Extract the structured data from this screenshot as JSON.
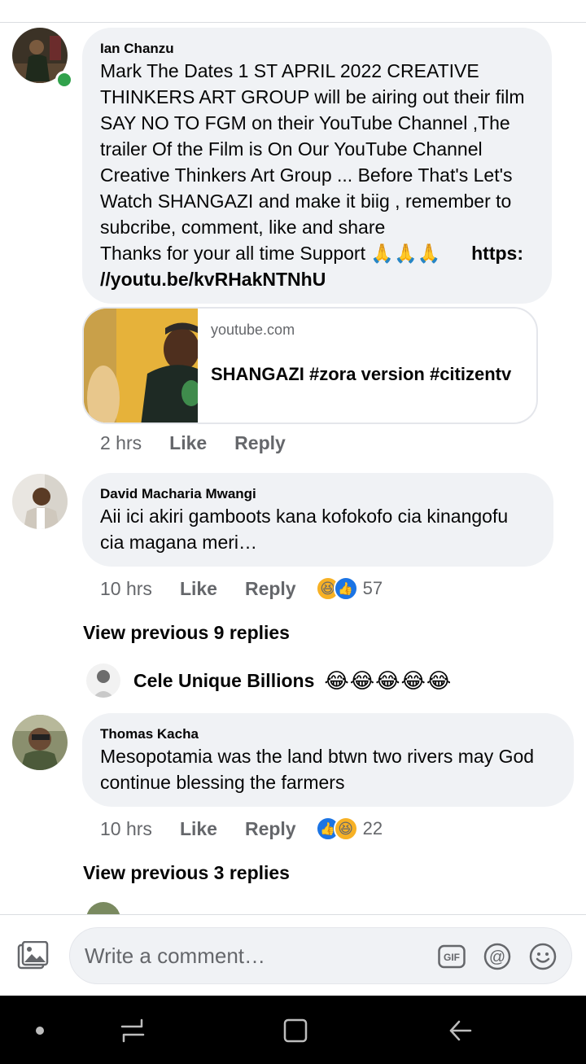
{
  "comments": [
    {
      "author": "Ian Chanzu",
      "lines": [
        "Mark The Dates 1 ST APRIL 2022 CREATIVE",
        "THINKERS ART GROUP will be airing out their film",
        "SAY NO TO FGM on their YouTube Channel ,The",
        "trailer Of the Film is On Our YouTube Channel",
        "Creative Thinkers Art Group ... Before That's Let's",
        "Watch SHANGAZI and make it biig , remember to",
        "subcribe, comment, like and share"
      ],
      "support_text": "Thanks for your all time Support 🙏🙏🙏",
      "link_part1": "https:",
      "link_part2": "//youtu.be/kvRHakNTNhU",
      "link_preview": {
        "domain": "youtube.com",
        "title": "SHANGAZI #zora version #citizentv"
      },
      "time": "2 hrs",
      "like_label": "Like",
      "reply_label": "Reply",
      "online": true
    },
    {
      "author": "David Macharia Mwangi",
      "lines": [
        "Aii ici akiri gamboots kana kofokofo cia kinangofu",
        "cia magana meri…"
      ],
      "time": "10 hrs",
      "like_label": "Like",
      "reply_label": "Reply",
      "reactions": [
        "haha",
        "like"
      ],
      "reaction_count": "57",
      "view_previous": "View previous 9 replies",
      "latest_reply": {
        "author": "Cele Unique Billions",
        "text": "😂😂😂😂😂"
      }
    },
    {
      "author": "Thomas Kacha",
      "lines": [
        "Mesopotamia was the land btwn two rivers may God",
        "continue blessing the farmers"
      ],
      "time": "10 hrs",
      "like_label": "Like",
      "reply_label": "Reply",
      "reactions": [
        "like",
        "haha"
      ],
      "reaction_count": "22",
      "view_previous": "View previous 3 replies"
    }
  ],
  "composer": {
    "placeholder": "Write a comment…",
    "gif_label": "GIF",
    "mention_label": "@"
  },
  "colors": {
    "bubble": "#f0f2f5",
    "secondary_text": "#65676b",
    "like_blue": "#1b74e4",
    "haha_yellow": "#f7b125",
    "online_green": "#31a24c"
  }
}
